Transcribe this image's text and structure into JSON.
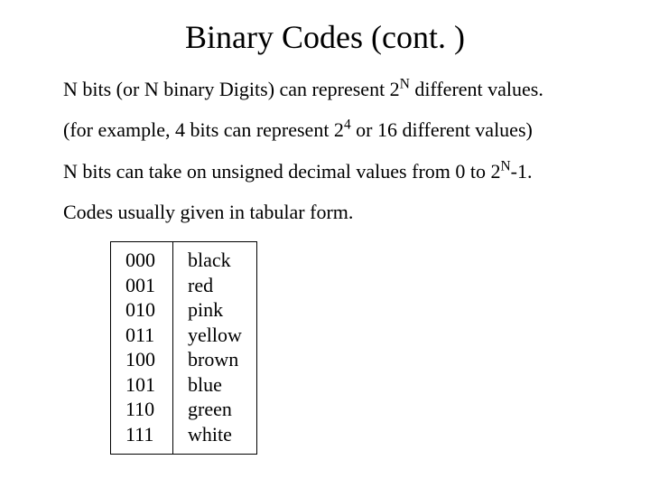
{
  "title": "Binary Codes (cont. )",
  "p1_a": "N bits (or N binary Digits) can represent 2",
  "p1_sup": "N",
  "p1_b": " different values.",
  "p2_a": "(for example, 4 bits can represent 2",
  "p2_sup": "4",
  "p2_b": " or 16 different values)",
  "p3_a": "N bits can take on unsigned decimal values from 0 to 2",
  "p3_sup": "N",
  "p3_b": "-1.",
  "p4": "Codes usually given in tabular form.",
  "codes": [
    {
      "bin": "000",
      "name": "black"
    },
    {
      "bin": "001",
      "name": "red"
    },
    {
      "bin": "010",
      "name": "pink"
    },
    {
      "bin": "011",
      "name": "yellow"
    },
    {
      "bin": "100",
      "name": "brown"
    },
    {
      "bin": "101",
      "name": "blue"
    },
    {
      "bin": "110",
      "name": "green"
    },
    {
      "bin": "111",
      "name": "white"
    }
  ]
}
